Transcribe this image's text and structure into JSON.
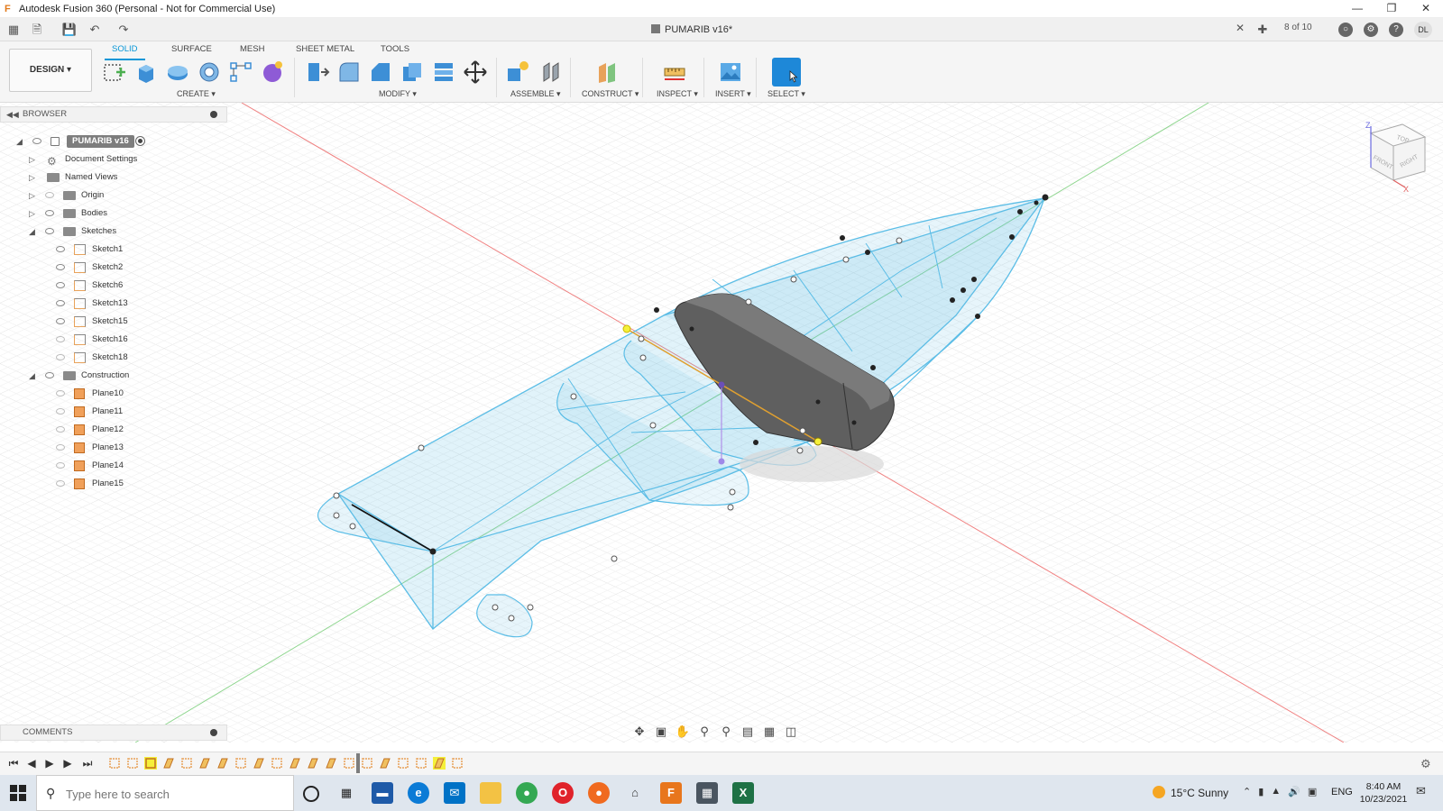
{
  "window": {
    "title": "Autodesk Fusion 360 (Personal - Not for Commercial Use)",
    "app_icon": "F"
  },
  "doc_tab": {
    "title": "PUMARIB v16*",
    "job_status": "8 of 10",
    "user_initials": "DL"
  },
  "workspace": {
    "selector_label": "DESIGN ▾"
  },
  "toolbar_tabs": [
    "SOLID",
    "SURFACE",
    "MESH",
    "SHEET METAL",
    "TOOLS"
  ],
  "tool_groups": {
    "create": "CREATE ▾",
    "modify": "MODIFY ▾",
    "assemble": "ASSEMBLE ▾",
    "construct": "CONSTRUCT ▾",
    "inspect": "INSPECT ▾",
    "insert": "INSERT ▾",
    "select": "SELECT ▾"
  },
  "browser": {
    "header": "BROWSER",
    "root": "PUMARIB v16",
    "items": [
      {
        "label": "Document Settings",
        "kind": "settings"
      },
      {
        "label": "Named Views",
        "kind": "folder"
      },
      {
        "label": "Origin",
        "kind": "folder"
      },
      {
        "label": "Bodies",
        "kind": "folder"
      },
      {
        "label": "Sketches",
        "kind": "folder"
      },
      {
        "label": "Sketch1",
        "kind": "sketch"
      },
      {
        "label": "Sketch2",
        "kind": "sketch"
      },
      {
        "label": "Sketch6",
        "kind": "sketch"
      },
      {
        "label": "Sketch13",
        "kind": "sketch"
      },
      {
        "label": "Sketch15",
        "kind": "sketch"
      },
      {
        "label": "Sketch16",
        "kind": "sketch"
      },
      {
        "label": "Sketch18",
        "kind": "sketch"
      },
      {
        "label": "Construction",
        "kind": "folder"
      },
      {
        "label": "Plane10",
        "kind": "plane"
      },
      {
        "label": "Plane11",
        "kind": "plane"
      },
      {
        "label": "Plane12",
        "kind": "plane"
      },
      {
        "label": "Plane13",
        "kind": "plane"
      },
      {
        "label": "Plane14",
        "kind": "plane"
      },
      {
        "label": "Plane15",
        "kind": "plane"
      }
    ]
  },
  "comments": {
    "header": "COMMENTS"
  },
  "viewcube": {
    "top": "TOP",
    "front": "FRONT",
    "right": "RIGHT",
    "axis_z": "Z",
    "axis_x": "X"
  },
  "taskbar": {
    "search_placeholder": "Type here to search",
    "weather": "15°C  Sunny",
    "language": "ENG",
    "time": "8:40 AM",
    "date": "10/23/2021"
  },
  "colors": {
    "accent": "#0696d7",
    "sketch_blue": "#5bbde6",
    "body_grey": "#5f5f5f"
  }
}
